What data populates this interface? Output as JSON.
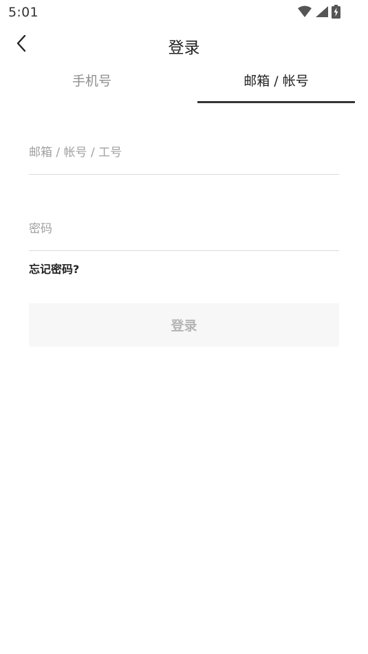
{
  "status_bar": {
    "time": "5:01",
    "icons": [
      "wifi-icon",
      "cell-signal-icon",
      "battery-charging-icon"
    ]
  },
  "header": {
    "back_icon": "chevron-left-icon",
    "title": "登录"
  },
  "tabs": [
    {
      "label": "手机号",
      "active": false
    },
    {
      "label": "邮箱 / 帐号",
      "active": true
    }
  ],
  "form": {
    "account": {
      "value": "",
      "placeholder": "邮箱 / 帐号 / 工号"
    },
    "password": {
      "value": "",
      "placeholder": "密码"
    },
    "forgot_label": "忘记密码?",
    "submit_label": "登录"
  },
  "colors": {
    "text_primary": "#222222",
    "text_inactive": "#8e8e8e",
    "placeholder": "#a0a0a0",
    "divider": "#d9d9d9",
    "tab_indicator": "#333333",
    "button_bg_disabled": "#f7f7f7",
    "button_text_disabled": "#b4b4b4"
  }
}
